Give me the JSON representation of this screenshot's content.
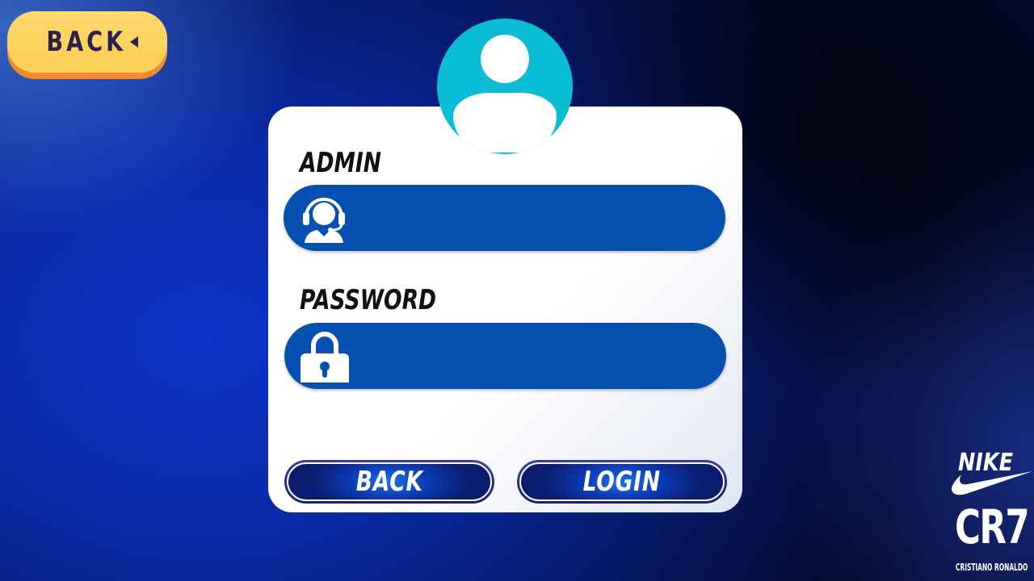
{
  "top_back": {
    "label": "BACK",
    "arrow_icon": "triangle-left-icon",
    "color": "#fbcf57",
    "shadow_color": "#f08a2e"
  },
  "avatar": {
    "icon": "user-avatar-icon",
    "color": "#0bbcd6"
  },
  "admin_field": {
    "label": "ADMIN",
    "value": "",
    "icon": "headset-user-icon",
    "color": "#0650b2"
  },
  "password_field": {
    "label": "PASSWORD",
    "value": "",
    "icon": "padlock-icon",
    "color": "#0650b2"
  },
  "buttons": {
    "back_label": "BACK",
    "login_label": "LOGIN"
  },
  "brand": {
    "nike": "NIKE",
    "swoosh_icon": "nike-swoosh-icon",
    "cr7": "CR7",
    "subtitle": "CRISTIANO RONALDO"
  }
}
